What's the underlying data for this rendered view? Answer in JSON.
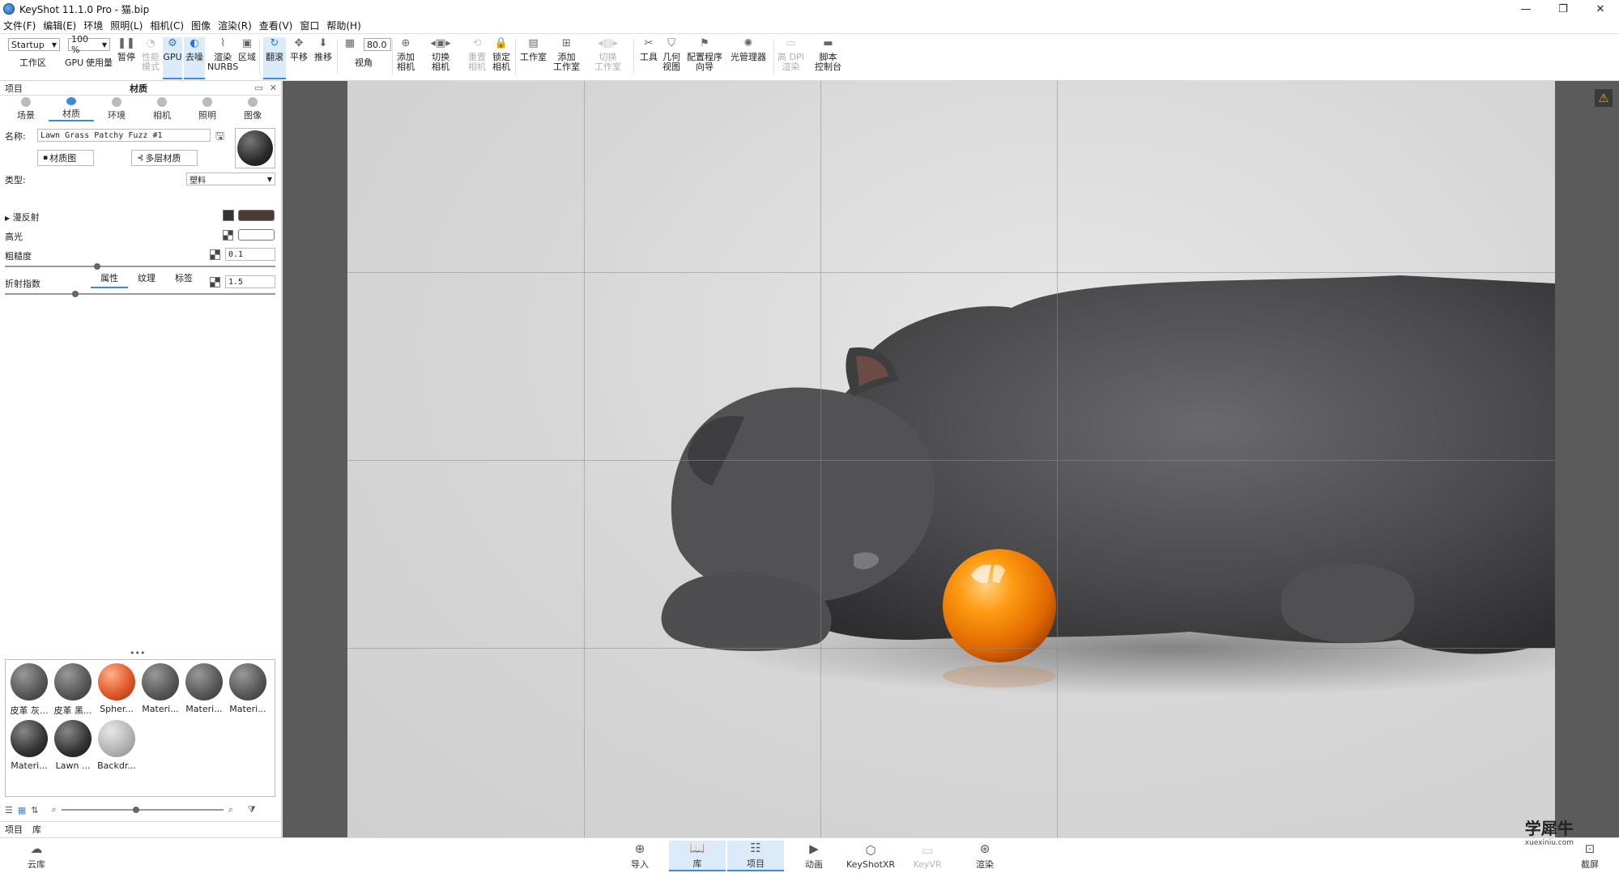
{
  "window": {
    "title": "KeyShot 11.1.0 Pro  - 猫.bip",
    "controls": [
      "—",
      "❐",
      "✕"
    ]
  },
  "menu": [
    "文件(F)",
    "编辑(E)",
    "环境",
    "照明(L)",
    "相机(C)",
    "图像",
    "渲染(R)",
    "查看(V)",
    "窗口",
    "帮助(H)"
  ],
  "toolbar": {
    "workspace_select": "Startup",
    "zoom_select": "100 %",
    "fov_value": "80.0",
    "items": [
      {
        "label": "工作区"
      },
      {
        "label": "GPU"
      },
      {
        "label": "使用量"
      },
      {
        "label": "暂停"
      },
      {
        "label": "性能\n模式"
      },
      {
        "label": "GPU"
      },
      {
        "label": "去噪"
      },
      {
        "label": "渲染\nNURBS"
      },
      {
        "label": "区域"
      },
      {
        "label": "翻滚"
      },
      {
        "label": "平移"
      },
      {
        "label": "推移"
      },
      {
        "label": "视角"
      },
      {
        "label": "添加\n相机"
      },
      {
        "label": "切换\n相机"
      },
      {
        "label": "重置\n相机"
      },
      {
        "label": "锁定\n相机"
      },
      {
        "label": "工作室"
      },
      {
        "label": "添加\n工作室"
      },
      {
        "label": "切换\n工作室"
      },
      {
        "label": "工具"
      },
      {
        "label": "几何\n视图"
      },
      {
        "label": "配置程序\n向导"
      },
      {
        "label": "光管理器"
      },
      {
        "label": "高 DPI\n渲染"
      },
      {
        "label": "脚本\n控制台"
      }
    ]
  },
  "panel": {
    "header_left": "项目",
    "header_title": "材质",
    "header_controls": [
      "▭",
      "✕"
    ],
    "tabs": [
      "场景",
      "材质",
      "环境",
      "相机",
      "照明",
      "图像"
    ],
    "name_label": "名称:",
    "name_value": "Lawn Grass Patchy Fuzz #1",
    "material_graph_btn": "材质图",
    "multi_layer_btn": "多层材质",
    "type_label": "类型:",
    "type_value": "塑料",
    "subtabs": [
      "属性",
      "纹理",
      "标签"
    ],
    "diffuse_label": "漫反射",
    "diffuse_color": "#4a3a33",
    "specular_label": "高光",
    "specular_color": "#ffffff",
    "roughness_label": "粗糙度",
    "roughness_value": "0.1",
    "roughness_fraction": 0.34,
    "ior_label": "折射指数",
    "ior_value": "1.5",
    "ior_fraction": 0.26,
    "library_dots": "•••",
    "thumbnails": [
      {
        "caption": "皮革 灰...",
        "kind": "grey"
      },
      {
        "caption": "皮革 黑...",
        "kind": "grey"
      },
      {
        "caption": "Spher...",
        "kind": "orange"
      },
      {
        "caption": "Materi...",
        "kind": "grey"
      },
      {
        "caption": "Materi...",
        "kind": "grey"
      },
      {
        "caption": "Materi...",
        "kind": "grey"
      },
      {
        "caption": "Materi...",
        "kind": "fuzz"
      },
      {
        "caption": "Lawn ...",
        "kind": "fuzz"
      },
      {
        "caption": "Backdr...",
        "kind": "light"
      }
    ],
    "bottom_tabs": [
      "项目",
      "库"
    ]
  },
  "viewport": {
    "warning_icon": "warning-icon"
  },
  "bottombar": {
    "cloud": "云库",
    "items": [
      {
        "label": "导入"
      },
      {
        "label": "库"
      },
      {
        "label": "项目"
      },
      {
        "label": "动画"
      },
      {
        "label": "KeyShotXR"
      },
      {
        "label": "KeyVR"
      },
      {
        "label": "渲染"
      }
    ],
    "screenshot": "截屏",
    "watermark_main": "学犀牛",
    "watermark_sub": "xuexiniu.com"
  },
  "colors": {
    "accent": "#3c8ad8",
    "ball_orange": "#ff8a00",
    "cat_grey": "#4f4f51"
  }
}
